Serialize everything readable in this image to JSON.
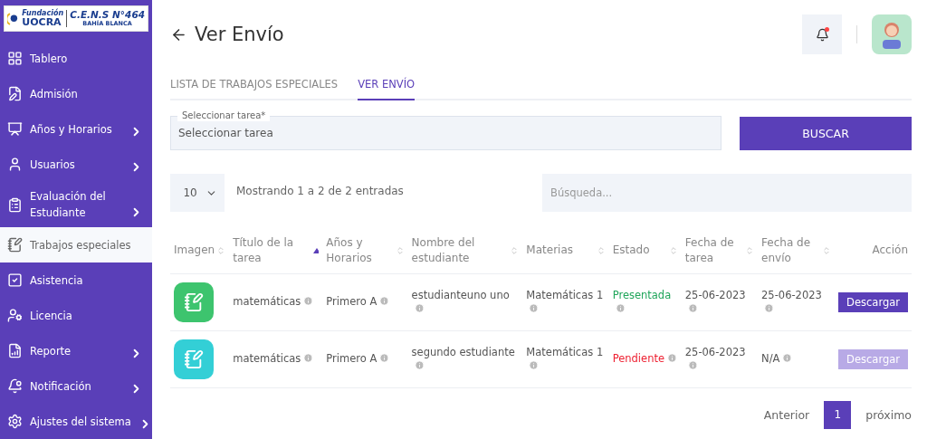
{
  "sidebar": {
    "logo": {
      "org": "Fundación",
      "brand": "UOCRA",
      "school": "C.E.N.S N°464",
      "city": "BAHÍA BLANCA"
    },
    "items": [
      {
        "label": "Tablero",
        "selected": false,
        "expandable": false
      },
      {
        "label": "Admisión",
        "selected": false,
        "expandable": false
      },
      {
        "label": "Años y Horarios",
        "selected": false,
        "expandable": true
      },
      {
        "label": "Usuarios",
        "selected": false,
        "expandable": true
      },
      {
        "label": "Evaluación del Estudiante",
        "selected": false,
        "expandable": true
      },
      {
        "label": "Trabajos especiales",
        "selected": true,
        "expandable": false
      },
      {
        "label": "Asistencia",
        "selected": false,
        "expandable": false
      },
      {
        "label": "Licencia",
        "selected": false,
        "expandable": false
      },
      {
        "label": "Reporte",
        "selected": false,
        "expandable": true
      },
      {
        "label": "Notificación",
        "selected": false,
        "expandable": true
      },
      {
        "label": "Ajustes del sistema",
        "selected": false,
        "expandable": true
      }
    ]
  },
  "header": {
    "title": "Ver Envío",
    "has_notification": true
  },
  "tabs": [
    {
      "label": "LISTA DE TRABAJOS ESPECIALES",
      "selected": false
    },
    {
      "label": "VER ENVÍO",
      "selected": true
    }
  ],
  "task_select": {
    "label": "Seleccionar tarea*",
    "value": "Seleccionar tarea"
  },
  "search_button": "BUSCAR",
  "table_controls": {
    "page_size": "10",
    "info": "Mostrando 1 a 2 de 2 entradas",
    "search_placeholder": "Búsqueda..."
  },
  "table": {
    "columns": [
      {
        "label": "Imagen",
        "sortable": true,
        "sorted": false
      },
      {
        "label": "Título de la tarea",
        "sortable": true,
        "sorted": true
      },
      {
        "label": "Años y Horarios",
        "sortable": true,
        "sorted": false
      },
      {
        "label": "Nombre del estudiante",
        "sortable": true,
        "sorted": false
      },
      {
        "label": "Materias",
        "sortable": true,
        "sorted": false
      },
      {
        "label": "Estado",
        "sortable": true,
        "sorted": false
      },
      {
        "label": "Fecha de tarea",
        "sortable": true,
        "sorted": false
      },
      {
        "label": "Fecha de envío",
        "sortable": true,
        "sorted": false
      },
      {
        "label": "Acción"
      }
    ],
    "rows": [
      {
        "color": "#3dc46e",
        "title": "matemáticas",
        "year": "Primero A",
        "student": "estudianteuno uno",
        "subject": "Matemáticas 1",
        "status": "Presentada",
        "submitted": true,
        "task_date": "25-06-2023",
        "submit_date": "25-06-2023",
        "action": "Descargar",
        "action_enabled": true
      },
      {
        "color": "#33cfd6",
        "title": "matemáticas",
        "year": "Primero A",
        "student": "segundo estudiante",
        "subject": "Matemáticas 1",
        "status": "Pendiente",
        "submitted": false,
        "task_date": "25-06-2023",
        "submit_date": "N/A",
        "action": "Descargar",
        "action_enabled": false
      }
    ]
  },
  "pagination": {
    "previous": "Anterior",
    "pages": [
      {
        "label": "1",
        "selected": true
      }
    ],
    "next": "próximo"
  }
}
